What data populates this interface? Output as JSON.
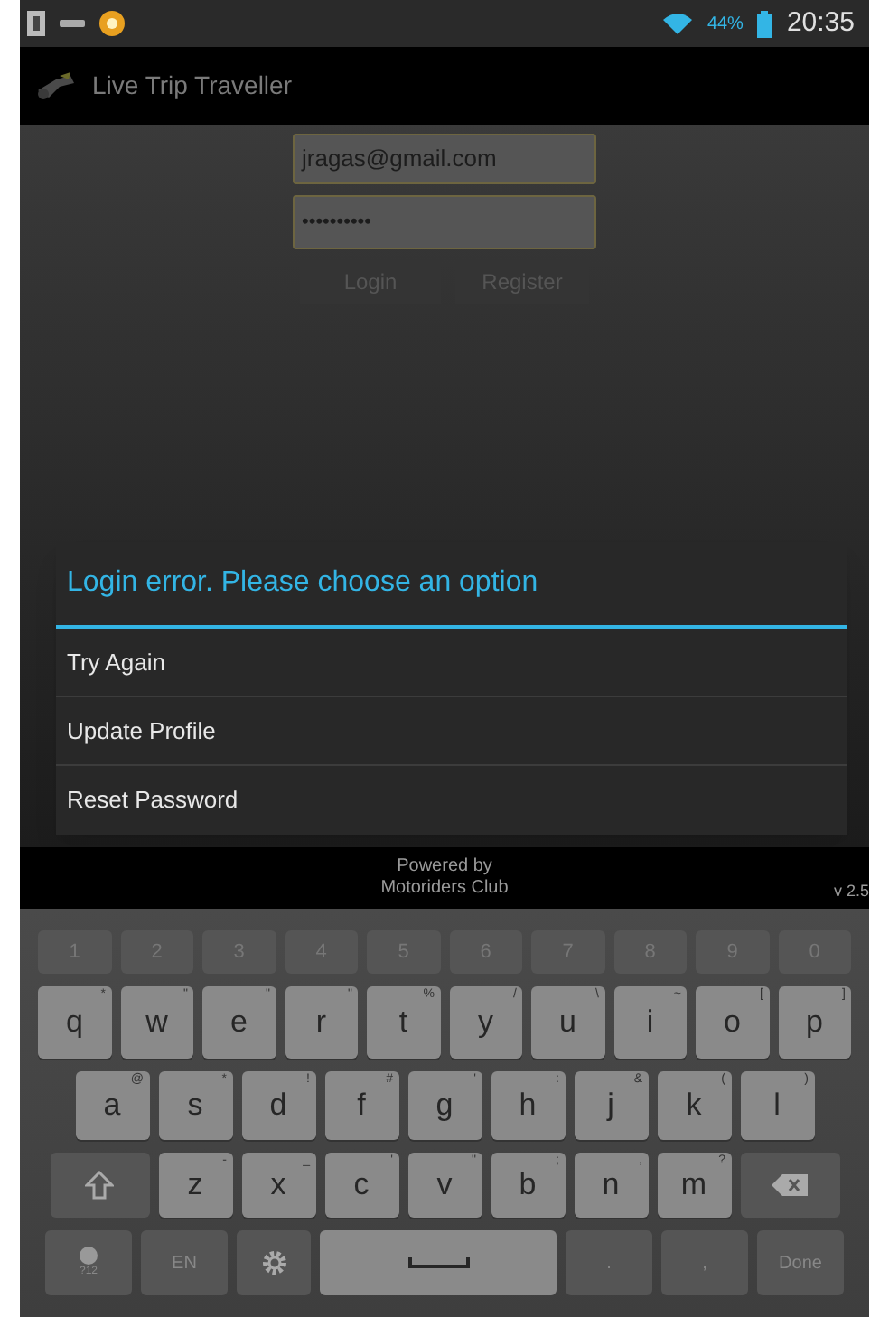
{
  "status_bar": {
    "battery_percent": "44%",
    "time": "20:35"
  },
  "app_bar": {
    "title": "Live Trip Traveller"
  },
  "form": {
    "email": {
      "value": "jragas@gmail.com"
    },
    "password": {
      "value": "••••••••••"
    },
    "buttons": [
      "Login",
      "Register"
    ]
  },
  "dialog": {
    "title": "Login error. Please choose an option",
    "options": [
      "Try Again",
      "Update Profile",
      "Reset Password"
    ]
  },
  "footer": {
    "powered_by": [
      "Powered by",
      "Motoriders Club"
    ],
    "version": "v 2.5"
  },
  "keyboard": {
    "rows": [
      [
        {
          "kind": "number",
          "label": "1"
        },
        {
          "kind": "number",
          "label": "2"
        },
        {
          "kind": "number",
          "label": "3"
        },
        {
          "kind": "number",
          "label": "4"
        },
        {
          "kind": "number",
          "label": "5"
        },
        {
          "kind": "number",
          "label": "6"
        },
        {
          "kind": "number",
          "label": "7"
        },
        {
          "kind": "number",
          "label": "8"
        },
        {
          "kind": "number",
          "label": "9"
        },
        {
          "kind": "number",
          "label": "0"
        }
      ],
      [
        {
          "kind": "char",
          "label": "q",
          "hint": "*"
        },
        {
          "kind": "char",
          "label": "w",
          "hint": "\""
        },
        {
          "kind": "char",
          "label": "e",
          "hint": "\""
        },
        {
          "kind": "char",
          "label": "r",
          "hint": "\""
        },
        {
          "kind": "char",
          "label": "t",
          "hint": "%"
        },
        {
          "kind": "char",
          "label": "y",
          "hint": "/"
        },
        {
          "kind": "char",
          "label": "u",
          "hint": "\\"
        },
        {
          "kind": "char",
          "label": "i",
          "hint": "~"
        },
        {
          "kind": "char",
          "label": "o",
          "hint": "["
        },
        {
          "kind": "char",
          "label": "p",
          "hint": "]"
        }
      ],
      [
        {
          "kind": "char",
          "label": "a",
          "hint": "@"
        },
        {
          "kind": "char",
          "label": "s",
          "hint": "*"
        },
        {
          "kind": "char",
          "label": "d",
          "hint": "!"
        },
        {
          "kind": "char",
          "label": "f",
          "hint": "#"
        },
        {
          "kind": "char",
          "label": "g",
          "hint": "'"
        },
        {
          "kind": "char",
          "label": "h",
          "hint": ":"
        },
        {
          "kind": "char",
          "label": "j",
          "hint": "&"
        },
        {
          "kind": "char",
          "label": "k",
          "hint": "("
        },
        {
          "kind": "char",
          "label": "l",
          "hint": ")"
        }
      ],
      [
        {
          "kind": "shift"
        },
        {
          "kind": "char",
          "label": "z",
          "hint": "-"
        },
        {
          "kind": "char",
          "label": "x",
          "hint": "_"
        },
        {
          "kind": "char",
          "label": "c",
          "hint": "'"
        },
        {
          "kind": "char",
          "label": "v",
          "hint": "\""
        },
        {
          "kind": "char",
          "label": "b",
          "hint": ";"
        },
        {
          "kind": "char",
          "label": "n",
          "hint": ","
        },
        {
          "kind": "char",
          "label": "m",
          "hint": "?"
        },
        {
          "kind": "backspace"
        }
      ],
      [
        {
          "kind": "emoji",
          "label": "?12"
        },
        {
          "kind": "func",
          "label": "EN"
        },
        {
          "kind": "settings"
        },
        {
          "kind": "space"
        },
        {
          "kind": "func",
          "label": "."
        },
        {
          "kind": "func",
          "label": ","
        },
        {
          "kind": "func",
          "label": "Done"
        }
      ]
    ]
  }
}
